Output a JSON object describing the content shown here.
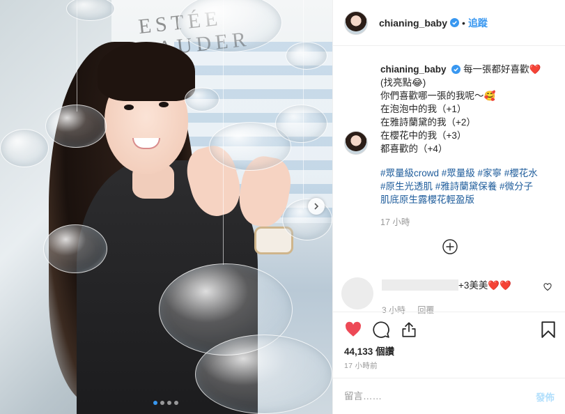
{
  "photo": {
    "brand_sign_text": "ESTÉE LAUDER",
    "carousel_count": 4,
    "carousel_active_index": 0
  },
  "header": {
    "username": "chianing_baby",
    "separator": "•",
    "follow_label": "追蹤"
  },
  "caption": {
    "username": "chianing_baby",
    "lines": [
      "每一張都好喜歡❤️",
      "(找亮點😂)",
      "你們喜歡哪一張的我呢～🥰",
      "在泡泡中的我（+1）",
      "在雅詩蘭黛的我（+2）",
      "在櫻花中的我（+3）",
      "都喜歡的（+4）"
    ],
    "hashtags_lines": [
      "#眾量級crowd #眾量級 #家寧 #櫻花水",
      "#原生光透肌 #雅詩蘭黛保養 #微分子",
      "肌底原生露櫻花輕盈版"
    ],
    "time": "17 小時"
  },
  "comment": {
    "text": "+3美美❤️❤️",
    "time": "3 小時",
    "reply_label": "回覆"
  },
  "stats": {
    "likes_count": "44,133",
    "likes_suffix": "個讚",
    "post_time": "17 小時前"
  },
  "add_comment": {
    "placeholder": "留言……",
    "post_label": "發佈"
  },
  "colors": {
    "link_blue": "#3897f0",
    "heart_red": "#ed4956",
    "hashtag_blue": "#1e5c9b",
    "muted_gray": "#999999",
    "post_disabled": "#b2dffc"
  },
  "icons": {
    "verified": "verified-badge-icon",
    "next": "chevron-right-icon",
    "load_more": "plus-circle-icon",
    "like": "heart-filled-icon",
    "comment": "speech-bubble-icon",
    "share": "share-upload-icon",
    "save": "bookmark-icon",
    "comment_like": "small-heart-icon"
  }
}
